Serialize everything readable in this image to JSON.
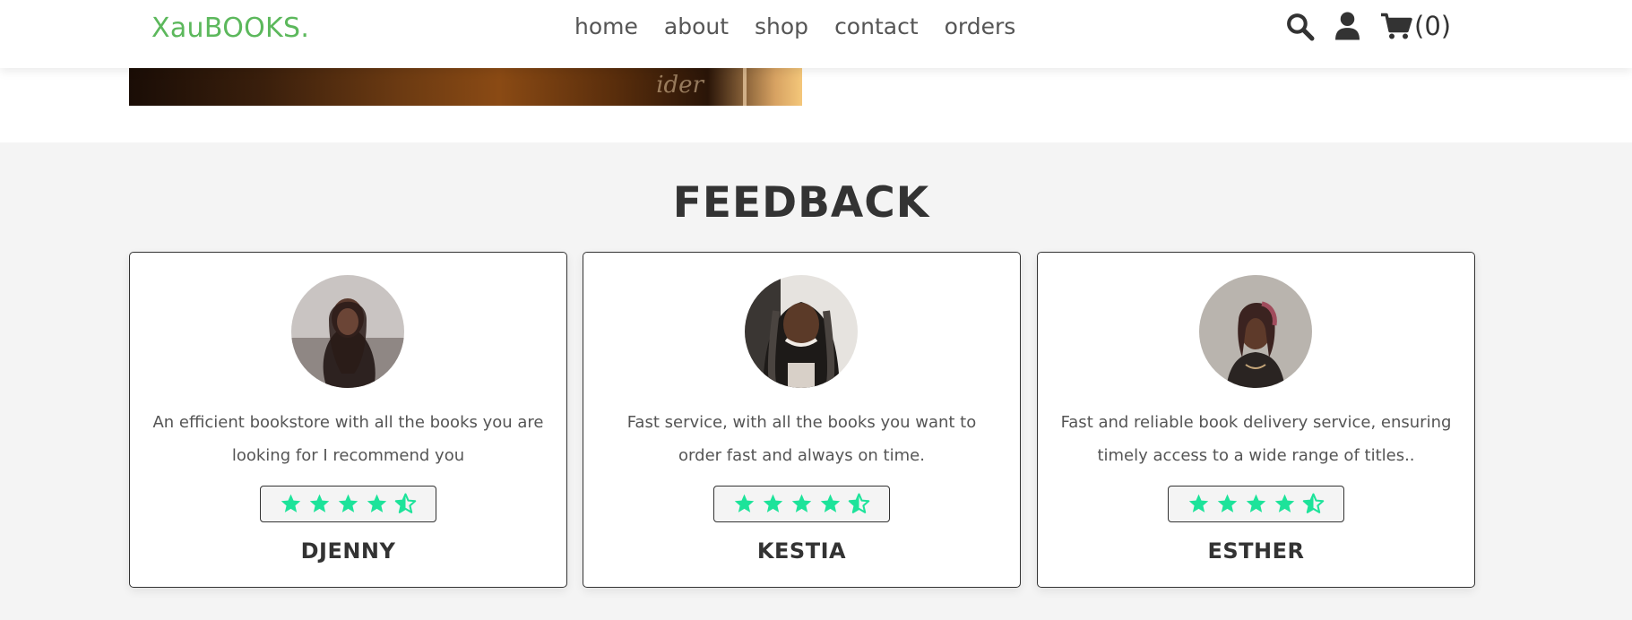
{
  "header": {
    "logo": "XauBOOKS.",
    "nav": [
      "home",
      "about",
      "shop",
      "contact",
      "orders"
    ],
    "icons": [
      "search-icon",
      "user-icon",
      "cart-icon"
    ],
    "cart_count": "(0)"
  },
  "feedback": {
    "title": "FEEDBACK",
    "reviews": [
      {
        "name": "DJENNY",
        "text": "An efficient bookstore with all the books you are looking for I recommend you",
        "rating": 4.5
      },
      {
        "name": "KESTIA",
        "text": "Fast service, with all the books you want to order fast and always on time.",
        "rating": 4.5
      },
      {
        "name": "ESTHER",
        "text": "Fast and reliable book delivery service, ensuring timely access to a wide range of titles..",
        "rating": 4.5
      }
    ]
  },
  "colors": {
    "logo": "#5cb85c",
    "star": "#1de39a",
    "text_dark": "#333333",
    "section_bg": "#f4f4f4"
  }
}
